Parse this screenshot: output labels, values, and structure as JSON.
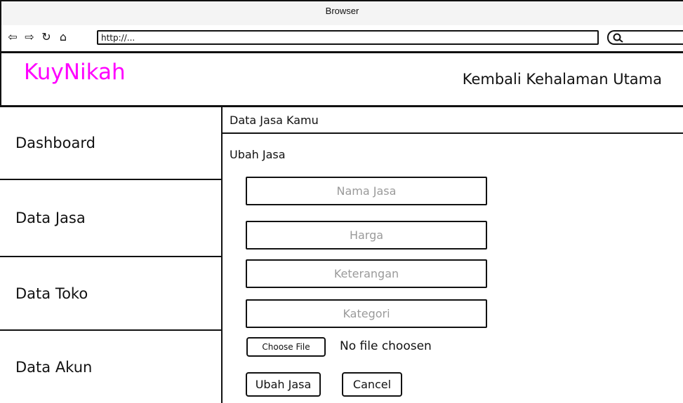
{
  "browser": {
    "title": "Browser",
    "url": "http://...",
    "nav_icons": [
      "back-arrow-icon",
      "forward-arrow-icon",
      "refresh-icon",
      "home-icon",
      "search-icon"
    ]
  },
  "header": {
    "brand": "KuyNikah",
    "home_link": "Kembali Kehalaman Utama",
    "brand_color": "#ff00ff"
  },
  "sidebar": {
    "items": [
      {
        "label": "Dashboard"
      },
      {
        "label": "Data Jasa"
      },
      {
        "label": "Data Toko"
      },
      {
        "label": "Data Akun"
      }
    ]
  },
  "main": {
    "heading": "Data Jasa Kamu",
    "section_title": "Ubah Jasa",
    "fields": {
      "name_placeholder": "Nama Jasa",
      "price_placeholder": "Harga",
      "description_placeholder": "Keterangan",
      "category_placeholder": "Kategori"
    },
    "file": {
      "button_label": "Choose File",
      "status": "No file choosen"
    },
    "actions": {
      "submit_label": "Ubah Jasa",
      "cancel_label": "Cancel"
    }
  }
}
